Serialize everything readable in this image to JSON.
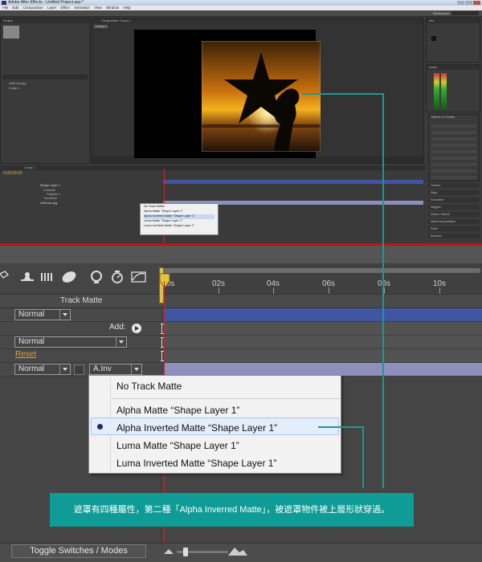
{
  "mini": {
    "title": "Adobe After Effects - Untitled Project.aep *",
    "menu": [
      "File",
      "Edit",
      "Composition",
      "Layer",
      "Effect",
      "Animation",
      "View",
      "Window",
      "Help"
    ],
    "workspace": "Workspace:",
    "composition_tab": "Composition: Comp 1",
    "project_tab": "Project",
    "comp1": "Comp 1",
    "timeline_tab": "Comp 1",
    "timecode": "0;00;00;00",
    "layers": [
      "Shape Layer 1",
      "Contents",
      "Polystar 1",
      "Transform",
      "child-sun.jpg"
    ],
    "dropdown": [
      "No Track Matte",
      "Alpha Matte “Shape Layer 1”",
      "Alpha Inverted Matte “Shape Layer 1”",
      "Luma Matte “Shape Layer 1”",
      "Luma Inverted Matte “Shape Layer 1”"
    ],
    "panels": [
      "Info",
      "Audio",
      "Effects & Presets",
      "Tracker",
      "Align",
      "Smoother",
      "Wiggler",
      "Motion Sketch",
      "Mask Interpolation",
      "Paint",
      "Brushes"
    ]
  },
  "timeline": {
    "ruler_ticks": [
      "0s",
      "02s",
      "04s",
      "06s",
      "08s",
      "10s"
    ],
    "column_header": "Track Matte",
    "mode_normal": "Normal",
    "add_label": "Add:",
    "reset_label": "Reset",
    "track_matte_value": "A.Inv"
  },
  "dropdown": {
    "items": [
      "No Track Matte",
      "Alpha Matte “Shape Layer 1”",
      "Alpha Inverted Matte “Shape Layer 1”",
      "Luma Matte “Shape Layer 1”",
      "Luma Inverted Matte “Shape Layer 1”"
    ],
    "selected_index": 2
  },
  "annotation": {
    "text": "遮罩有四種屬性，第二種「Alpha Inverred Matte」，被遮罩物件被上層形狀穿過。"
  },
  "bottom": {
    "toggle_label": "Toggle Switches / Modes"
  },
  "colors": {
    "annotation_bg": "#0f9b96",
    "layer_bar_blue": "#4056a0",
    "layer_bar_lavender": "#8d8fbd",
    "reset_orange": "#d8a238",
    "cti_red": "#c62a2a"
  }
}
